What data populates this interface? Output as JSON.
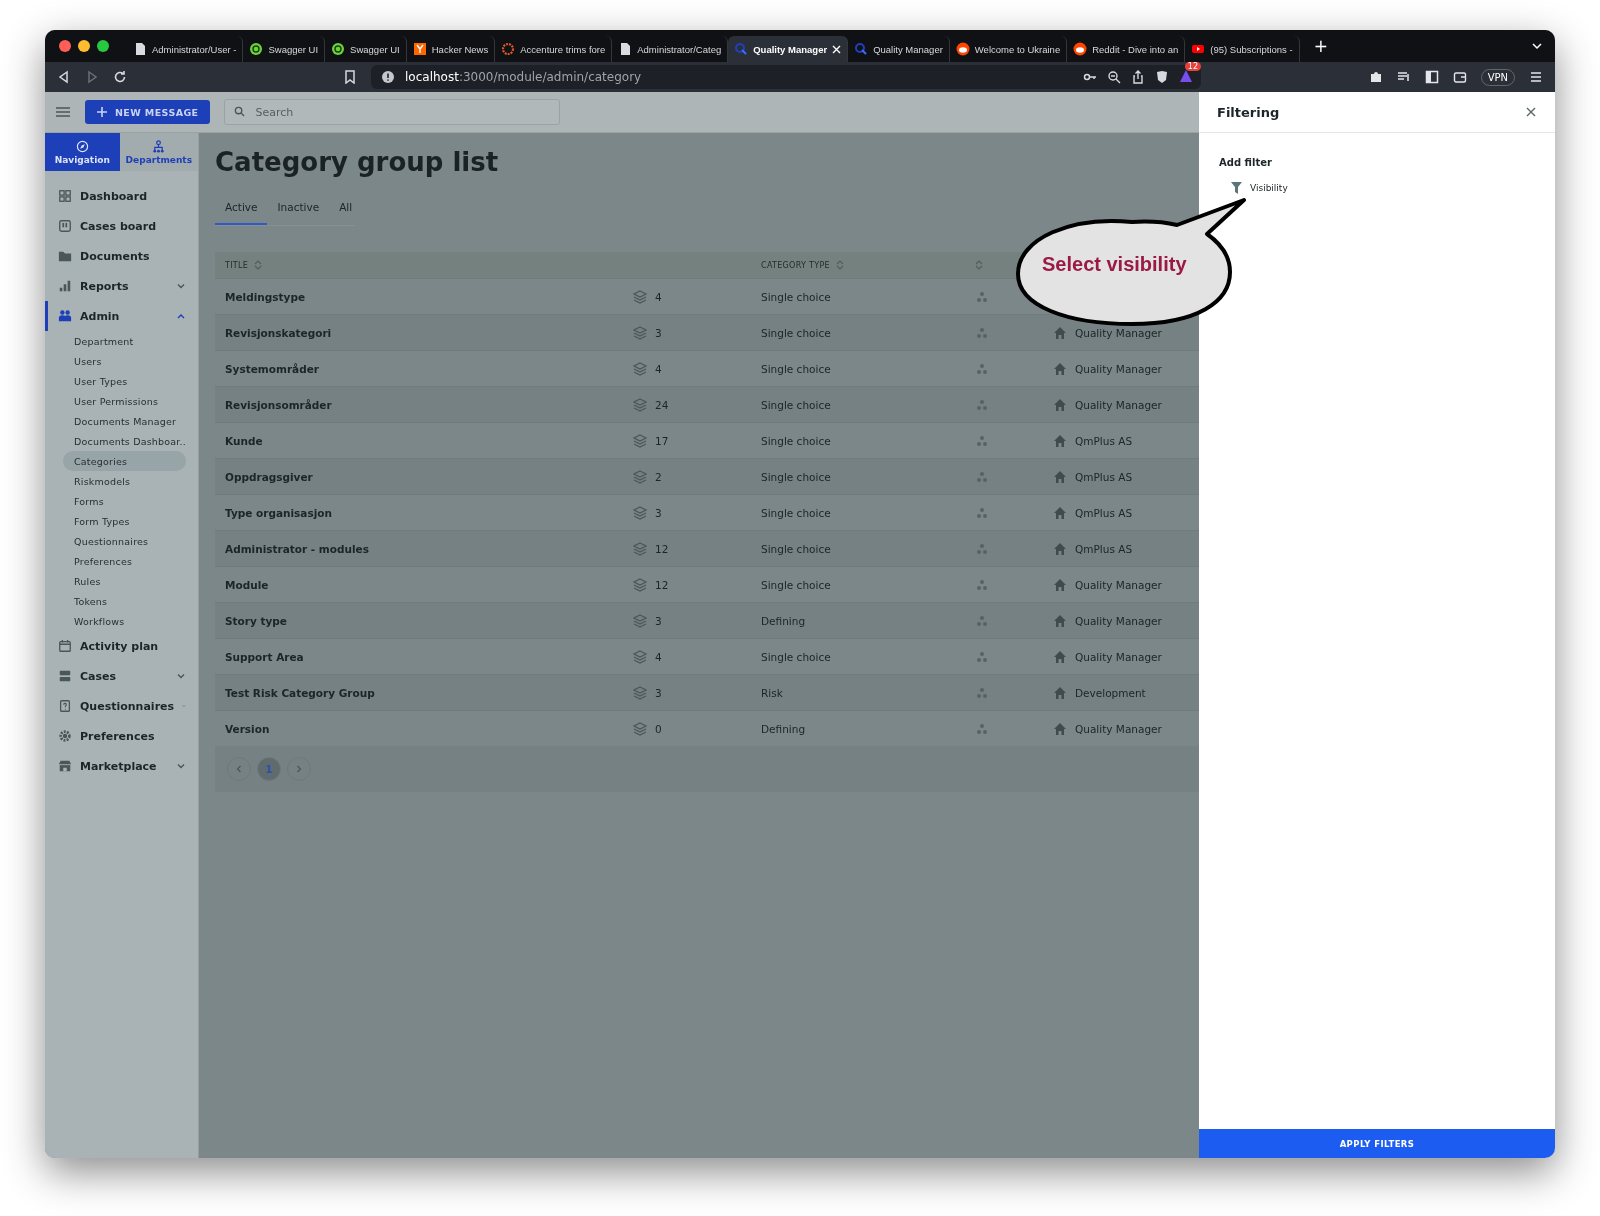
{
  "browser": {
    "tabs": [
      {
        "title": "Administrator/User -",
        "kind": "doc",
        "selected": false
      },
      {
        "title": "Swagger UI",
        "kind": "swagger",
        "selected": false
      },
      {
        "title": "Swagger UI",
        "kind": "swagger",
        "selected": false
      },
      {
        "title": "Hacker News",
        "kind": "hn",
        "selected": false
      },
      {
        "title": "Accenture trims fore",
        "kind": "ring",
        "selected": false
      },
      {
        "title": "Administrator/Categ",
        "kind": "doc",
        "selected": false
      },
      {
        "title": "Quality Manager",
        "kind": "qm",
        "selected": true
      },
      {
        "title": "Quality Manager",
        "kind": "qm",
        "selected": false
      },
      {
        "title": "Welcome to Ukraine",
        "kind": "reddit",
        "selected": false
      },
      {
        "title": "Reddit - Dive into an",
        "kind": "reddit",
        "selected": false
      },
      {
        "title": "(95) Subscriptions -",
        "kind": "youtube",
        "selected": false
      }
    ],
    "new_tab": "+",
    "url_host": "localhost",
    "url_path": ":3000/module/admin/category",
    "rewards_badge": "12",
    "vpn": "VPN"
  },
  "header": {
    "new_message": "NEW MESSAGE",
    "search": {
      "placeholder": "Search"
    }
  },
  "sidebar": {
    "tabs": [
      {
        "label": "Navigation",
        "selected": true
      },
      {
        "label": "Departments",
        "selected": false
      }
    ],
    "items": [
      {
        "label": "Dashboard",
        "kind": "link",
        "selected": false
      },
      {
        "label": "Cases board",
        "kind": "link",
        "selected": false
      },
      {
        "label": "Documents",
        "kind": "link",
        "selected": false
      },
      {
        "label": "Reports",
        "kind": "group",
        "selected": false,
        "expanded": false
      },
      {
        "label": "Admin",
        "kind": "group",
        "selected": true,
        "expanded": true,
        "children": [
          {
            "label": "Department",
            "selected": false
          },
          {
            "label": "Users",
            "selected": false
          },
          {
            "label": "User Types",
            "selected": false
          },
          {
            "label": "User Permissions",
            "selected": false
          },
          {
            "label": "Documents Manager",
            "selected": false
          },
          {
            "label": "Documents Dashboar..",
            "selected": false
          },
          {
            "label": "Categories",
            "selected": true
          },
          {
            "label": "Riskmodels",
            "selected": false
          },
          {
            "label": "Forms",
            "selected": false
          },
          {
            "label": "Form Types",
            "selected": false
          },
          {
            "label": "Questionnaires",
            "selected": false
          },
          {
            "label": "Preferences",
            "selected": false
          },
          {
            "label": "Rules",
            "selected": false
          },
          {
            "label": "Tokens",
            "selected": false
          },
          {
            "label": "Workflows",
            "selected": false
          }
        ]
      },
      {
        "label": "Activity plan",
        "kind": "link",
        "selected": false
      },
      {
        "label": "Cases",
        "kind": "group",
        "selected": false,
        "expanded": false
      },
      {
        "label": "Questionnaires",
        "kind": "group",
        "selected": false,
        "expanded": false
      },
      {
        "label": "Preferences",
        "kind": "link",
        "selected": false
      },
      {
        "label": "Marketplace",
        "kind": "group",
        "selected": false,
        "expanded": false
      }
    ]
  },
  "page": {
    "title": "Category group list",
    "tabs": [
      {
        "label": "Active",
        "selected": true
      },
      {
        "label": "Inactive",
        "selected": false
      },
      {
        "label": "All",
        "selected": false
      }
    ],
    "table": {
      "columns": [
        {
          "label": "TITLE",
          "sortable": true
        },
        {
          "sortable": false
        },
        {
          "label": "CATEGORY TYPE",
          "sortable": true
        },
        {
          "sortable": true
        }
      ],
      "rows": [
        {
          "title": "Meldingstype",
          "count": "4",
          "type": "Single choice"
        },
        {
          "title": "Revisjonskategori",
          "count": "3",
          "type": "Single choice",
          "organization": "Quality Manager"
        },
        {
          "title": "Systemområder",
          "count": "4",
          "type": "Single choice",
          "organization": "Quality Manager"
        },
        {
          "title": "Revisjonsområder",
          "count": "24",
          "type": "Single choice",
          "organization": "Quality Manager"
        },
        {
          "title": "Kunde",
          "count": "17",
          "type": "Single choice",
          "organization": "QmPlus AS"
        },
        {
          "title": "Oppdragsgiver",
          "count": "2",
          "type": "Single choice",
          "organization": "QmPlus AS"
        },
        {
          "title": "Type organisasjon",
          "count": "3",
          "type": "Single choice",
          "organization": "QmPlus AS"
        },
        {
          "title": "Administrator - modules",
          "count": "12",
          "type": "Single choice",
          "organization": "QmPlus AS"
        },
        {
          "title": "Module",
          "count": "12",
          "type": "Single choice",
          "organization": "Quality Manager"
        },
        {
          "title": "Story type",
          "count": "3",
          "type": "Defining",
          "organization": "Quality Manager"
        },
        {
          "title": "Support Area",
          "count": "4",
          "type": "Single choice",
          "organization": "Quality Manager"
        },
        {
          "title": "Test Risk Category Group",
          "count": "3",
          "type": "Risk",
          "organization": "Development"
        },
        {
          "title": "Version",
          "count": "0",
          "type": "Defining",
          "organization": "Quality Manager"
        }
      ]
    },
    "pagination": {
      "pages": [
        {
          "label": "1",
          "selected": true
        }
      ]
    }
  },
  "filter_panel": {
    "title": "Filtering",
    "add_filter": "Add filter",
    "filters": [
      {
        "label": "Visibility"
      }
    ],
    "apply": "APPLY FILTERS"
  },
  "callout": {
    "text": "Select visibility"
  }
}
